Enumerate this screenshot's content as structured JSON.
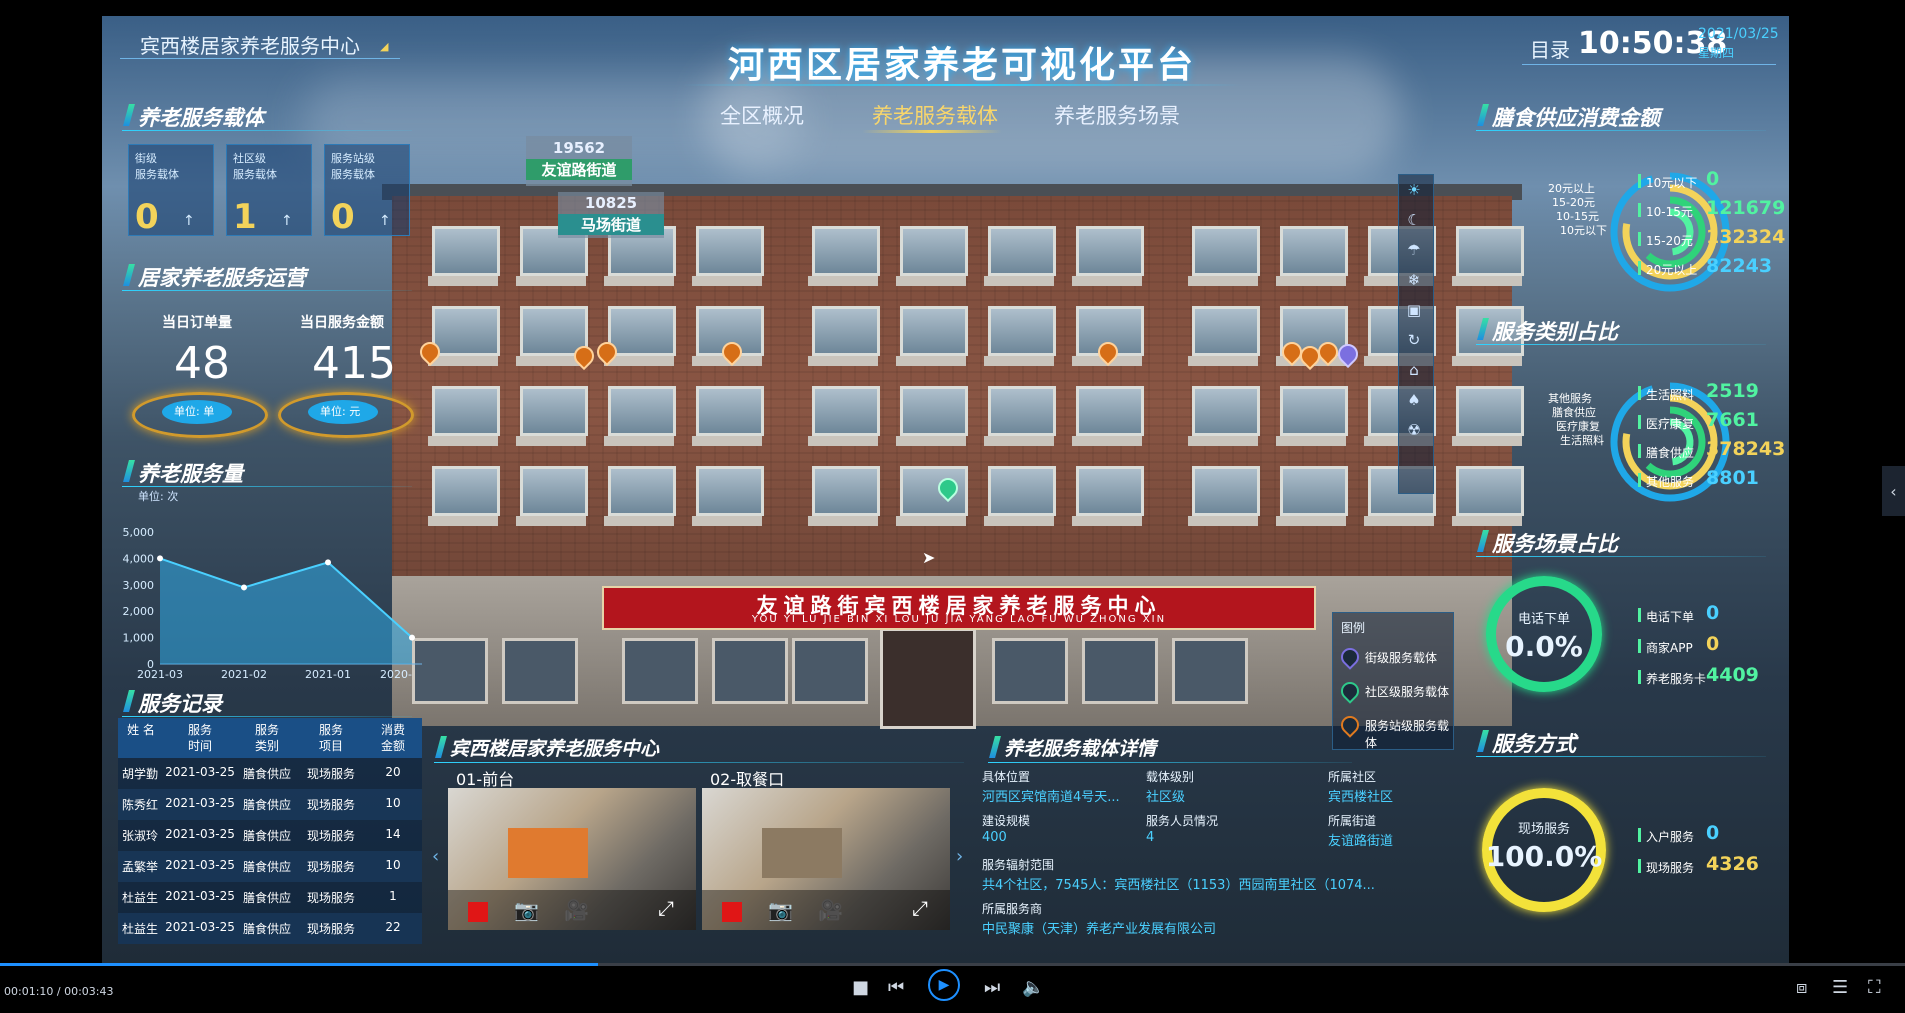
{
  "header": {
    "center_name": "宾西楼居家养老服务中心",
    "title": "河西区居家养老可视化平台",
    "directory": "目录",
    "time": "10:50:38",
    "date": "2021/03/25",
    "weekday": "星期四",
    "tabs": [
      {
        "label": "全区概况"
      },
      {
        "label": "养老服务载体"
      },
      {
        "label": "养老服务场景"
      }
    ]
  },
  "carriers": {
    "title": "养老服务载体",
    "items": [
      {
        "line1": "街级",
        "line2": "服务载体",
        "value": "0",
        "arrow": "↑"
      },
      {
        "line1": "社区级",
        "line2": "服务载体",
        "value": "1",
        "arrow": "↑"
      },
      {
        "line1": "服务站级",
        "line2": "服务载体",
        "value": "0",
        "arrow": "↑"
      }
    ]
  },
  "operation": {
    "title": "居家养老服务运营",
    "orders_label": "当日订单量",
    "orders_value": "48",
    "orders_unit": "单位: 单",
    "amount_label": "当日服务金额",
    "amount_value": "415",
    "amount_unit": "单位: 元"
  },
  "volume": {
    "title": "养老服务量",
    "unit": "单位: 次"
  },
  "chart_data": {
    "type": "area",
    "categories": [
      "2021-03",
      "2021-02",
      "2021-01",
      "2020-"
    ],
    "values": [
      4000,
      2900,
      3850,
      1000
    ],
    "ylim": [
      0,
      5000
    ],
    "yticks": [
      "5,000",
      "4,000",
      "3,000",
      "2,000",
      "1,000",
      "0"
    ],
    "ylabel": "单位: 次",
    "grid": false
  },
  "records": {
    "title": "服务记录",
    "headers": [
      [
        "姓 名",
        ""
      ],
      [
        "服务",
        "时间"
      ],
      [
        "服务",
        "类别"
      ],
      [
        "服务",
        "项目"
      ],
      [
        "消费",
        "金额"
      ]
    ],
    "rows": [
      [
        "胡学勤",
        "2021-03-25",
        "膳食供应",
        "现场服务",
        "20"
      ],
      [
        "陈秀红",
        "2021-03-25",
        "膳食供应",
        "现场服务",
        "10"
      ],
      [
        "张淑玲",
        "2021-03-25",
        "膳食供应",
        "现场服务",
        "14"
      ],
      [
        "孟繁举",
        "2021-03-25",
        "膳食供应",
        "现场服务",
        "10"
      ],
      [
        "杜益生",
        "2021-03-25",
        "膳食供应",
        "现场服务",
        "1"
      ],
      [
        "杜益生",
        "2021-03-25",
        "膳食供应",
        "现场服务",
        "22"
      ]
    ]
  },
  "map": {
    "popup1_count": "19562",
    "popup1_street": "友谊路街道",
    "popup2_count": "10825",
    "popup2_street": "马场街道",
    "sign_text": "友谊路街宾西楼居家养老服务中心",
    "sign_pinyin": "YOU YI LU JIE BIN XI LOU JU JIA YANG LAO FU WU ZHONG XIN",
    "legend_title": "图例",
    "legend": [
      {
        "label": "街级服务载体",
        "color": "#7b6fe0"
      },
      {
        "label": "社区级服务载体",
        "color": "#2ec98a"
      },
      {
        "label": "服务站级服务载体",
        "color": "#e07a1f"
      }
    ]
  },
  "camera": {
    "title": "宾西楼居家养老服务中心",
    "feeds": [
      {
        "label": "01-前台"
      },
      {
        "label": "02-取餐口"
      }
    ]
  },
  "detail": {
    "title": "养老服务载体详情",
    "location_label": "具体位置",
    "location_value": "河西区宾馆南道4号天...",
    "level_label": "载体级别",
    "level_value": "社区级",
    "community_label": "所属社区",
    "community_value": "宾西楼社区",
    "scale_label": "建设规模",
    "scale_value": "400",
    "staff_label": "服务人员情况",
    "staff_value": "4",
    "street_label": "所属街道",
    "street_value": "友谊路街道",
    "radiation_label": "服务辐射范围",
    "radiation_value": "共4个社区，7545人：宾西楼社区（1153）西园南里社区（1074...",
    "provider_label": "所属服务商",
    "provider_value": "中民聚康（天津）养老产业发展有限公司"
  },
  "meal": {
    "title": "膳食供应消费金额",
    "ring_labels": [
      "20元以上",
      "15-20元",
      "10-15元",
      "10元以下"
    ],
    "items": [
      {
        "label": "10元以下",
        "value": "0",
        "cls": "num-g"
      },
      {
        "label": "10-15元",
        "value": "121679",
        "cls": "num-g"
      },
      {
        "label": "15-20元",
        "value": "132324",
        "cls": "num-y"
      },
      {
        "label": "20元以上",
        "value": "82243",
        "cls": "num-c"
      }
    ]
  },
  "category": {
    "title": "服务类别占比",
    "ring_labels": [
      "其他服务",
      "膳食供应",
      "医疗康复",
      "生活照料"
    ],
    "items": [
      {
        "label": "生活照料",
        "value": "2519",
        "cls": "num-g"
      },
      {
        "label": "医疗康复",
        "value": "7661",
        "cls": "num-g"
      },
      {
        "label": "膳食供应",
        "value": "378243",
        "cls": "num-y"
      },
      {
        "label": "其他服务",
        "value": "8801",
        "cls": "num-c"
      }
    ]
  },
  "scene": {
    "title": "服务场景占比",
    "ring_label": "电话下单",
    "ring_value": "0.0%",
    "items": [
      {
        "label": "电话下单",
        "value": "0",
        "cls": "num-c"
      },
      {
        "label": "商家APP",
        "value": "0",
        "cls": "num-y"
      },
      {
        "label": "养老服务卡",
        "value": "4409",
        "cls": "num-g"
      }
    ]
  },
  "mode": {
    "title": "服务方式",
    "ring_label": "现场服务",
    "ring_value": "100.0%",
    "items": [
      {
        "label": "入户服务",
        "value": "0",
        "cls": "num-c"
      },
      {
        "label": "现场服务",
        "value": "4326",
        "cls": "num-y"
      }
    ]
  },
  "player": {
    "time": "00:01:10 / 00:03:43",
    "progress": 0.314
  },
  "colors": {
    "accent": "#2fd3ff",
    "yellow": "#f3d35a",
    "green": "#51f3a1",
    "red_sign": "#b3151d"
  }
}
